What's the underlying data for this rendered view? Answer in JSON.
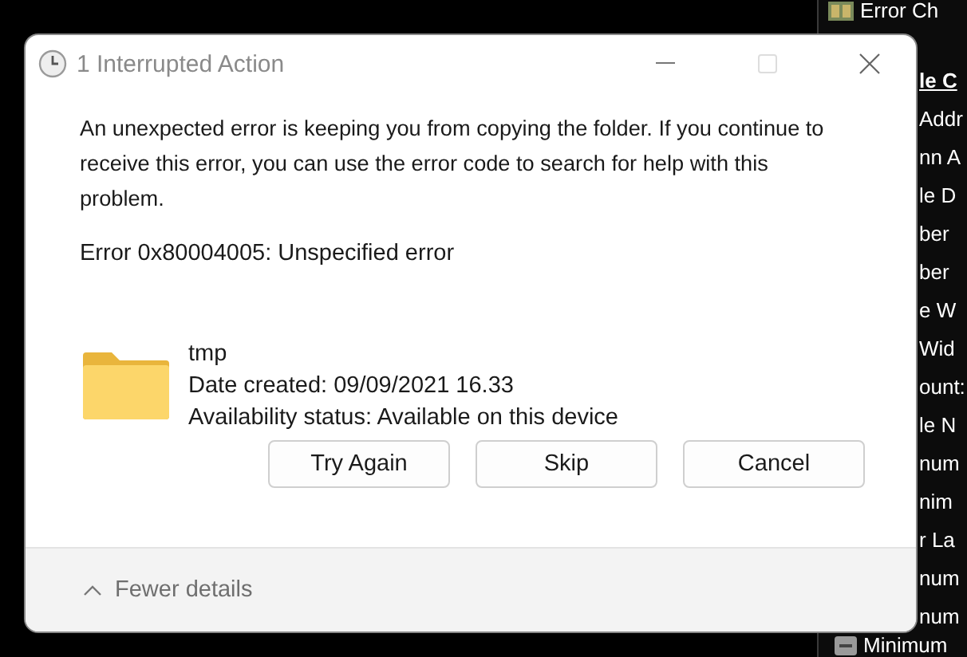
{
  "background_window": {
    "header": "Error Ch",
    "items": [
      {
        "text": "le C",
        "kind": "heading"
      },
      {
        "text": "Addr",
        "kind": "item"
      },
      {
        "text": "nn A",
        "kind": "item"
      },
      {
        "text": "le D",
        "kind": "item"
      },
      {
        "text": "ber",
        "kind": "item"
      },
      {
        "text": "ber",
        "kind": "item"
      },
      {
        "text": "e W",
        "kind": "item"
      },
      {
        "text": "Wid",
        "kind": "item"
      },
      {
        "text": "ount:",
        "kind": "item"
      },
      {
        "text": "le N",
        "kind": "item"
      },
      {
        "text": "num",
        "kind": "item"
      },
      {
        "text": "nim",
        "kind": "item"
      },
      {
        "text": "r La",
        "kind": "item"
      },
      {
        "text": "num",
        "kind": "item"
      },
      {
        "text": "num",
        "kind": "item"
      }
    ],
    "footer": "Minimum"
  },
  "dialog": {
    "title": "1 Interrupted Action",
    "message": "An unexpected error is keeping you from copying the folder. If you continue to receive this error, you can use the error code to search for help with this problem.",
    "error": "Error 0x80004005: Unspecified error",
    "file": {
      "name": "tmp",
      "details": [
        "Date created: 09/09/2021 16.33",
        "Availability status: Available on this device"
      ]
    },
    "buttons": [
      "Try Again",
      "Skip",
      "Cancel"
    ],
    "details_toggle": {
      "label": "Fewer details",
      "expanded": true
    }
  }
}
